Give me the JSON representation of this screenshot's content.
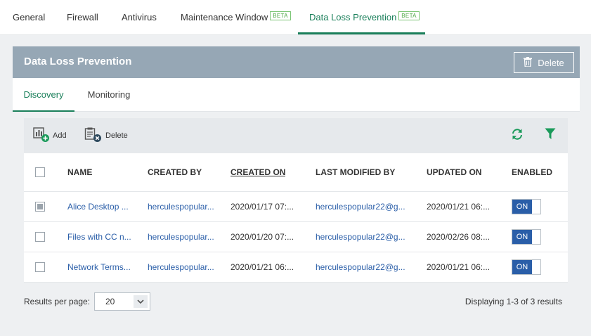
{
  "top_tabs": [
    {
      "label": "General"
    },
    {
      "label": "Firewall"
    },
    {
      "label": "Antivirus"
    },
    {
      "label": "Maintenance Window",
      "badge": "BETA"
    },
    {
      "label": "Data Loss Prevention",
      "badge": "BETA",
      "active": true
    }
  ],
  "panel": {
    "title": "Data Loss Prevention",
    "delete_label": "Delete"
  },
  "sub_tabs": [
    {
      "label": "Discovery",
      "active": true
    },
    {
      "label": "Monitoring"
    }
  ],
  "toolbar": {
    "add_label": "Add",
    "delete_label": "Delete",
    "refresh_icon": "refresh-icon",
    "filter_icon": "filter-icon"
  },
  "table": {
    "columns": [
      "NAME",
      "CREATED BY",
      "CREATED ON",
      "LAST MODIFIED BY",
      "UPDATED ON",
      "ENABLED"
    ],
    "sorted_column": "CREATED ON",
    "rows": [
      {
        "selected": "partial",
        "name": "Alice Desktop ...",
        "created_by": "herculespopular...",
        "created_on": "2020/01/17 07:...",
        "modified_by": "herculespopular22@g...",
        "updated_on": "2020/01/21 06:...",
        "enabled": "ON"
      },
      {
        "selected": false,
        "name": "Files with CC n...",
        "created_by": "herculespopular...",
        "created_on": "2020/01/20 07:...",
        "modified_by": "herculespopular22@g...",
        "updated_on": "2020/02/26 08:...",
        "enabled": "ON"
      },
      {
        "selected": false,
        "name": "Network Terms...",
        "created_by": "herculespopular...",
        "created_on": "2020/01/21 06:...",
        "modified_by": "herculespopular22@g...",
        "updated_on": "2020/01/21 06:...",
        "enabled": "ON"
      }
    ]
  },
  "footer": {
    "results_label": "Results per page:",
    "per_page_value": "20",
    "displaying": "Displaying 1-3 of 3 results"
  },
  "colors": {
    "accent": "#1a7f5a",
    "header_bar": "#96a7b5",
    "link": "#2a5ea8",
    "toggle_on": "#2a5ea8"
  }
}
